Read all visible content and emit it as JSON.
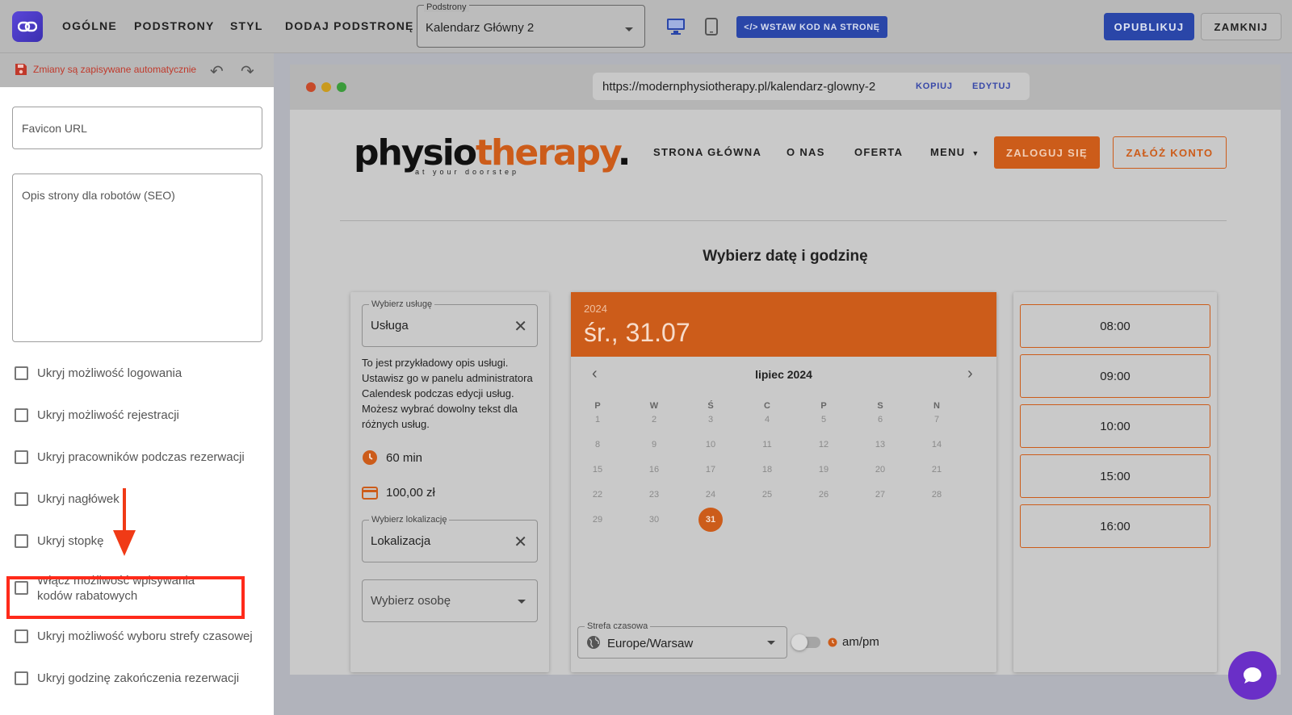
{
  "toolbar": {
    "nav": [
      "OGÓLNE",
      "PODSTRONY",
      "STYL",
      "DODAJ PODSTRONĘ"
    ],
    "page_select_label": "Podstrony",
    "page_select_value": "Kalendarz Główny 2",
    "embed_label": "WSTAW KOD NA STRONĘ",
    "publish_label": "OPUBLIKUJ",
    "close_label": "ZAMKNIJ",
    "accent": "#2a46a8"
  },
  "sidebar": {
    "autosave_text": "Zmiany są zapisywane automatycznie",
    "favicon_placeholder": "Favicon URL",
    "seo_placeholder": "Opis strony dla robotów (SEO)",
    "checkboxes": [
      {
        "label": "Ukryj możliwość logowania",
        "checked": false
      },
      {
        "label": "Ukryj możliwość rejestracji",
        "checked": false
      },
      {
        "label": "Ukryj pracowników podczas rezerwacji",
        "checked": false
      },
      {
        "label": "Ukryj nagłówek",
        "checked": false
      },
      {
        "label": "Ukryj stopkę",
        "checked": false
      },
      {
        "label": "Włącz możliwość wpisywania kodów rabatowych",
        "checked": false
      },
      {
        "label": "Ukryj możliwość wyboru strefy czasowej",
        "checked": false
      },
      {
        "label": "Ukryj godzinę zakończenia rezerwacji",
        "checked": false
      }
    ],
    "highlight_color": "#ff2a1a"
  },
  "preview": {
    "url": "https://modernphysiotherapy.pl/kalendarz-glowny-2",
    "copy_label": "KOPIUJ",
    "edit_label": "EDYTUJ",
    "logo_part1": "physio",
    "logo_part2": "therapy",
    "logo_dot": ".",
    "logo_tagline": "at your doorstep",
    "site_nav": [
      "STRONA GŁÓWNA",
      "O NAS",
      "OFERTA",
      "MENU"
    ],
    "login_label": "ZALOGUJ SIĘ",
    "register_label": "ZAŁÓŻ KONTO",
    "headline": "Wybierz datę i godzinę",
    "brand_color": "#cc5c1a",
    "booking": {
      "service_label": "Wybierz usługę",
      "service_value": "Usługa",
      "description": "To jest przykładowy opis usługi. Ustawisz go w panelu administratora Calendesk podczas edycji usług. Możesz wybrać dowolny tekst dla różnych usług.",
      "duration": "60 min",
      "price": "100,00 zł",
      "location_label": "Wybierz lokalizację",
      "location_value": "Lokalizacja",
      "person_placeholder": "Wybierz osobę"
    },
    "calendar": {
      "year": "2024",
      "selected_date": "śr., 31.07",
      "month_label": "lipiec 2024",
      "weekdays": [
        "P",
        "W",
        "Ś",
        "C",
        "P",
        "S",
        "N"
      ],
      "days": [
        "1",
        "2",
        "3",
        "4",
        "5",
        "6",
        "7",
        "8",
        "9",
        "10",
        "11",
        "12",
        "13",
        "14",
        "15",
        "16",
        "17",
        "18",
        "19",
        "20",
        "21",
        "22",
        "23",
        "24",
        "25",
        "26",
        "27",
        "28",
        "29",
        "30",
        "31"
      ],
      "selected_day": "31",
      "timezone_label": "Strefa czasowa",
      "timezone_value": "Europe/Warsaw",
      "ampm_label": "am/pm"
    },
    "time_slots": [
      "08:00",
      "09:00",
      "10:00",
      "15:00",
      "16:00"
    ]
  }
}
